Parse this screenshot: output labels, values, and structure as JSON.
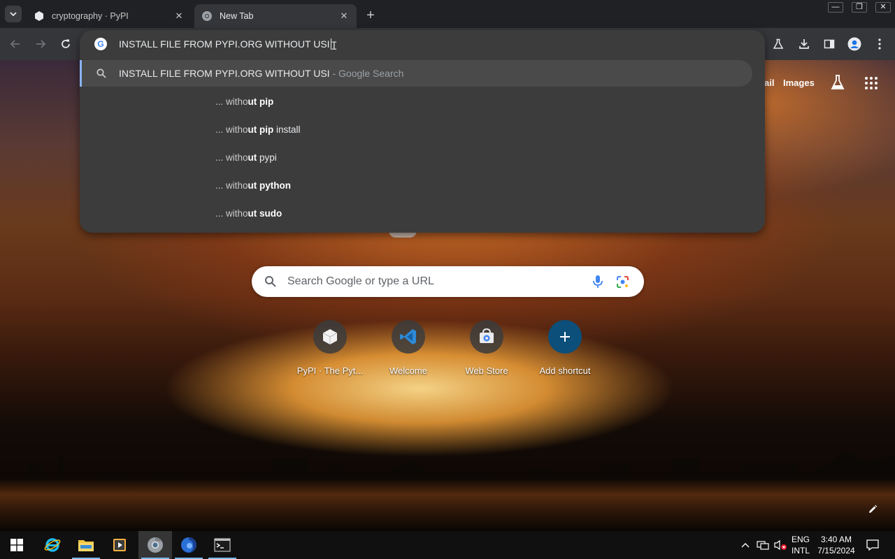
{
  "browser": {
    "tabs": [
      {
        "title": "cryptography · PyPI",
        "active": false
      },
      {
        "title": "New Tab",
        "active": true
      }
    ],
    "tab_close_glyph": "✕",
    "new_tab_glyph": "+",
    "window_controls": {
      "minimize": "—",
      "restore": "❐",
      "close": "✕"
    }
  },
  "omnibox": {
    "input_text": "INSTALL FILE FROM PYPI.ORG WITHOUT USI",
    "main_suggestion": {
      "query": "INSTALL FILE FROM PYPI.ORG WITHOUT USI",
      "separator": " - ",
      "source": "Google Search"
    },
    "suggestions": [
      {
        "lead": "... witho",
        "bold": "ut pip",
        "rest": ""
      },
      {
        "lead": "... witho",
        "bold": "ut pip",
        "rest": " install"
      },
      {
        "lead": "... witho",
        "bold": "ut",
        "rest": " pypi"
      },
      {
        "lead": "... witho",
        "bold": "ut python",
        "rest": ""
      },
      {
        "lead": "... witho",
        "bold": "ut sudo",
        "rest": ""
      }
    ]
  },
  "ntp": {
    "links": {
      "gmail": "ail",
      "images": "Images"
    },
    "search_placeholder": "Search Google or type a URL",
    "shortcuts": [
      {
        "label": "PyPI · The Pyt...",
        "icon": "pypi-cube-icon"
      },
      {
        "label": "Welcome",
        "icon": "vscode-icon"
      },
      {
        "label": "Web Store",
        "icon": "web-store-icon"
      },
      {
        "label": "Add shortcut",
        "icon": "plus-icon"
      }
    ]
  },
  "taskbar": {
    "lang_line1": "ENG",
    "lang_line2": "INTL",
    "time": "3:40 AM",
    "date": "7/15/2024"
  },
  "colors": {
    "accent": "#8ab4f8",
    "omnibox_bg": "#3c3c3c",
    "toolbar_bg": "#35363a",
    "taskbar_bg": "#101010"
  }
}
